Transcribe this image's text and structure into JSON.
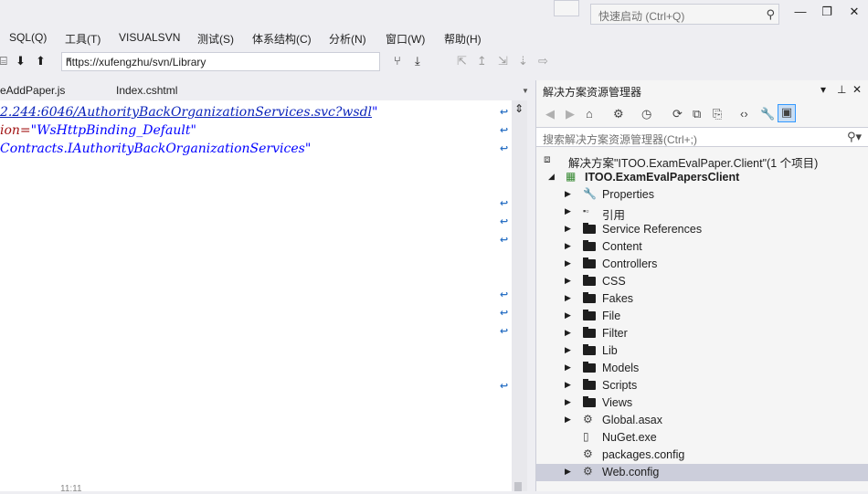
{
  "titlebar": {
    "quick_launch_placeholder": "快速启动 (Ctrl+Q)",
    "minimize": "—",
    "restore": "❐",
    "close": "✕"
  },
  "menu": [
    {
      "label": "SQL(Q)"
    },
    {
      "label": "工具(T)"
    },
    {
      "label": "VISUALSVN"
    },
    {
      "label": "测试(S)"
    },
    {
      "label": "体系结构(C)"
    },
    {
      "label": "分析(N)"
    },
    {
      "label": "窗口(W)"
    },
    {
      "label": "帮助(H)"
    }
  ],
  "toolbar": {
    "url_value": "https://xufengzhu/svn/Library"
  },
  "tabs": [
    {
      "label": "eAddPaper.js"
    },
    {
      "label": "Index.cshtml"
    }
  ],
  "editor": {
    "line1": "2.244:6046/AuthorityBackOrganizationServices.svc?wsdl",
    "line1_end": "\"",
    "line2_attr": "ion=",
    "line2_value": "\"WsHttpBinding_Default\"",
    "line3": "Contracts.IAuthorityBackOrganizationServices\"",
    "line_number": "11:11"
  },
  "solution_explorer": {
    "title": "解决方案资源管理器",
    "search_placeholder": "搜索解决方案资源管理器(Ctrl+;)",
    "solution_label": "解决方案\"ITOO.ExamEvalPaper.Client\"(1 个项目)",
    "project_label": "ITOO.ExamEvalPapersClient",
    "items": [
      {
        "label": "Properties",
        "icon": "wrench-icon"
      },
      {
        "label": "引用",
        "icon": "references-icon"
      },
      {
        "label": "Service References",
        "icon": "folder-icon"
      },
      {
        "label": "Content",
        "icon": "folder-icon"
      },
      {
        "label": "Controllers",
        "icon": "folder-icon"
      },
      {
        "label": "CSS",
        "icon": "folder-icon"
      },
      {
        "label": "Fakes",
        "icon": "folder-icon"
      },
      {
        "label": "File",
        "icon": "folder-icon"
      },
      {
        "label": "Filter",
        "icon": "folder-icon"
      },
      {
        "label": "Lib",
        "icon": "folder-icon"
      },
      {
        "label": "Models",
        "icon": "folder-icon"
      },
      {
        "label": "Scripts",
        "icon": "folder-icon"
      },
      {
        "label": "Views",
        "icon": "folder-icon"
      },
      {
        "label": "Global.asax",
        "icon": "config-file-icon"
      },
      {
        "label": "NuGet.exe",
        "icon": "file-icon"
      },
      {
        "label": "packages.config",
        "icon": "config-file-icon"
      },
      {
        "label": "Web.config",
        "icon": "config-file-icon"
      }
    ]
  },
  "colors": {
    "link": "#0b24ba",
    "string": "#a31515",
    "selected_row": "#cccedb",
    "chrome": "#eeeef2"
  }
}
